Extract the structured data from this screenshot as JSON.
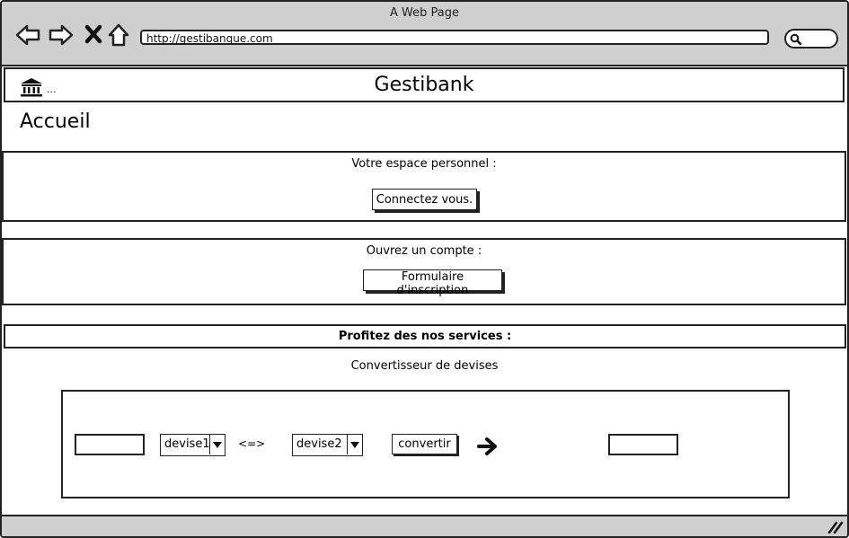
{
  "browser": {
    "window_title": "A Web Page",
    "url": "http://gestibanque.com",
    "icons": [
      "back-icon",
      "forward-icon",
      "close-icon",
      "home-icon",
      "search-icon"
    ]
  },
  "header": {
    "logo_icon": "bank-icon",
    "logo_suffix": "...",
    "title": "Gestibank"
  },
  "page": {
    "title": "Accueil"
  },
  "personal_space": {
    "label": "Votre espace personnel :",
    "button_label": "Connectez vous."
  },
  "open_account": {
    "label": "Ouvrez un compte :",
    "button_label": "Formulaire d'inscription"
  },
  "services": {
    "heading": "Profitez des nos services :"
  },
  "converter": {
    "caption": "Convertisseur de devises",
    "amount_input": "",
    "currency_from": "devise1",
    "equivalence": "<=>",
    "currency_to": "devise2",
    "convert_button": "convertir",
    "result_output": ""
  },
  "colors": {
    "chrome": "#cfcfcf",
    "border": "#222222",
    "background": "#ffffff"
  }
}
